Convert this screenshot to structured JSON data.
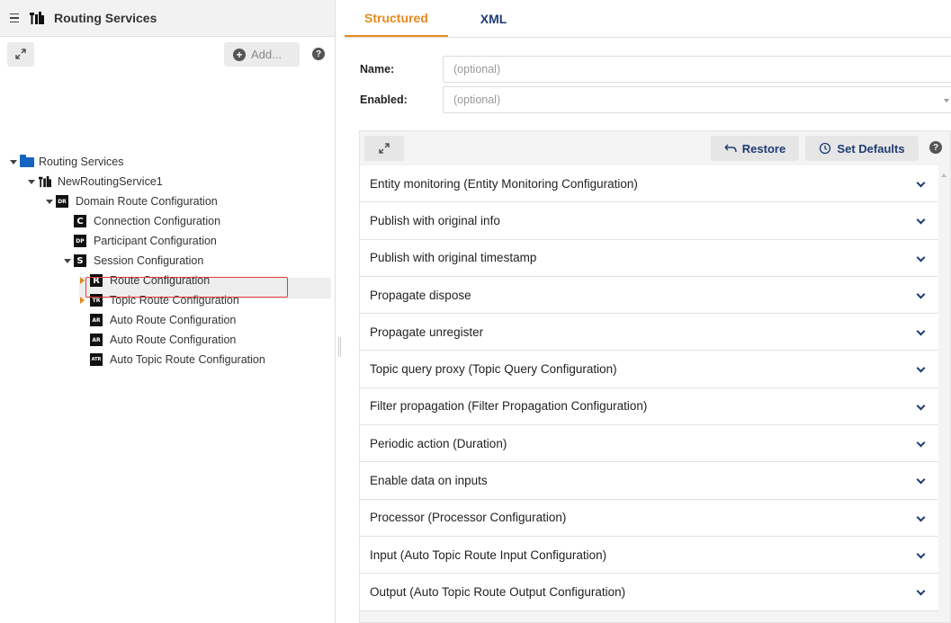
{
  "header": {
    "title": "Routing Services"
  },
  "toolbar": {
    "add_label": "Add...",
    "help": "?"
  },
  "tree": {
    "root": "Routing Services",
    "service": "NewRoutingService1",
    "domain": {
      "badge": "DR",
      "label": "Domain Route Configuration"
    },
    "connection": {
      "badge": "C",
      "label": "Connection Configuration"
    },
    "participant": {
      "badge": "DP",
      "label": "Participant Configuration"
    },
    "session": {
      "badge": "S",
      "label": "Session Configuration"
    },
    "route": {
      "badge": "R",
      "label": "Route Configuration"
    },
    "topic_route": {
      "badge": "TR",
      "label": "Topic Route Configuration"
    },
    "auto_route_1": {
      "badge": "AR",
      "label": "Auto Route Configuration"
    },
    "auto_route_2": {
      "badge": "AR",
      "label": "Auto Route Configuration"
    },
    "auto_topic_route": {
      "badge": "ATR",
      "label": "Auto Topic Route Configuration"
    }
  },
  "tabs": [
    {
      "label": "Structured",
      "active": true
    },
    {
      "label": "XML",
      "active": false
    }
  ],
  "form": {
    "name_label": "Name:",
    "name_placeholder": "(optional)",
    "enabled_label": "Enabled:",
    "enabled_placeholder": "(optional)"
  },
  "panel": {
    "restore_label": "Restore",
    "defaults_label": "Set Defaults",
    "help": "?"
  },
  "sections": [
    "Entity monitoring (Entity Monitoring Configuration)",
    "Publish with original info",
    "Publish with original timestamp",
    "Propagate dispose",
    "Propagate unregister",
    "Topic query proxy (Topic Query Configuration)",
    "Filter propagation (Filter Propagation Configuration)",
    "Periodic action (Duration)",
    "Enable data on inputs",
    "Processor (Processor Configuration)",
    "Input (Auto Topic Route Input Configuration)",
    "Output (Auto Topic Route Output Configuration)"
  ],
  "colors": {
    "accent": "#e68a1e",
    "link": "#1f3b73",
    "selection_border": "#e53935",
    "folder": "#1565c0"
  }
}
